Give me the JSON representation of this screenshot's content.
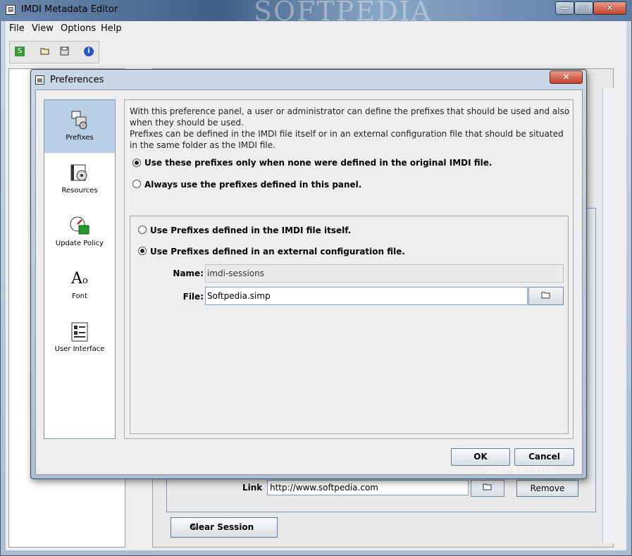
{
  "app": {
    "title": "IMDI Metadata Editor",
    "watermark": "SOFTPEDIA"
  },
  "window_buttons": {
    "minimize": "—",
    "maximize": "□",
    "close": "✕"
  },
  "menu": [
    {
      "label": "File"
    },
    {
      "label": "View"
    },
    {
      "label": "Options"
    },
    {
      "label": "Help"
    }
  ],
  "toolbar": {
    "icons": [
      "new-session-icon",
      "open-folder-icon",
      "save-icon",
      "info-icon"
    ]
  },
  "background": {
    "link_label": "Link",
    "link_value": "http://www.softpedia.com",
    "remove_label": "Remove",
    "clear_session_label": "Clear Session"
  },
  "dialog": {
    "title": "Preferences",
    "close": "✕",
    "categories": [
      {
        "label": "Prefixes",
        "icon": "prefixes-icon",
        "selected": true
      },
      {
        "label": "Resources",
        "icon": "resources-icon",
        "selected": false
      },
      {
        "label": "Update Policy",
        "icon": "update-policy-icon",
        "selected": false
      },
      {
        "label": "Font",
        "icon": "font-icon",
        "selected": false
      },
      {
        "label": "User Interface",
        "icon": "user-interface-icon",
        "selected": false
      }
    ],
    "description_1": "With this preference panel, a user or administrator can define the prefixes that should be used and also when they should be used.",
    "description_2": "Prefixes can be defined in the IMDI file itself or in an external configuration file that should be situated in the same folder as the IMDI file.",
    "option_use_only_when_none": "Use these prefixes only when none were defined in the original IMDI file.",
    "option_always_use": "Always use the prefixes defined in this panel.",
    "option_in_imdi_file": "Use Prefixes defined in the IMDI file itself.",
    "option_external_file": "Use Prefixes defined in an external configuration file.",
    "name_label": "Name:",
    "name_value": "imdi-sessions",
    "file_label": "File:",
    "file_value": "Softpedia.simp",
    "ok_label": "OK",
    "cancel_label": "Cancel",
    "footer_watermark": "SOFTPEDIA"
  }
}
